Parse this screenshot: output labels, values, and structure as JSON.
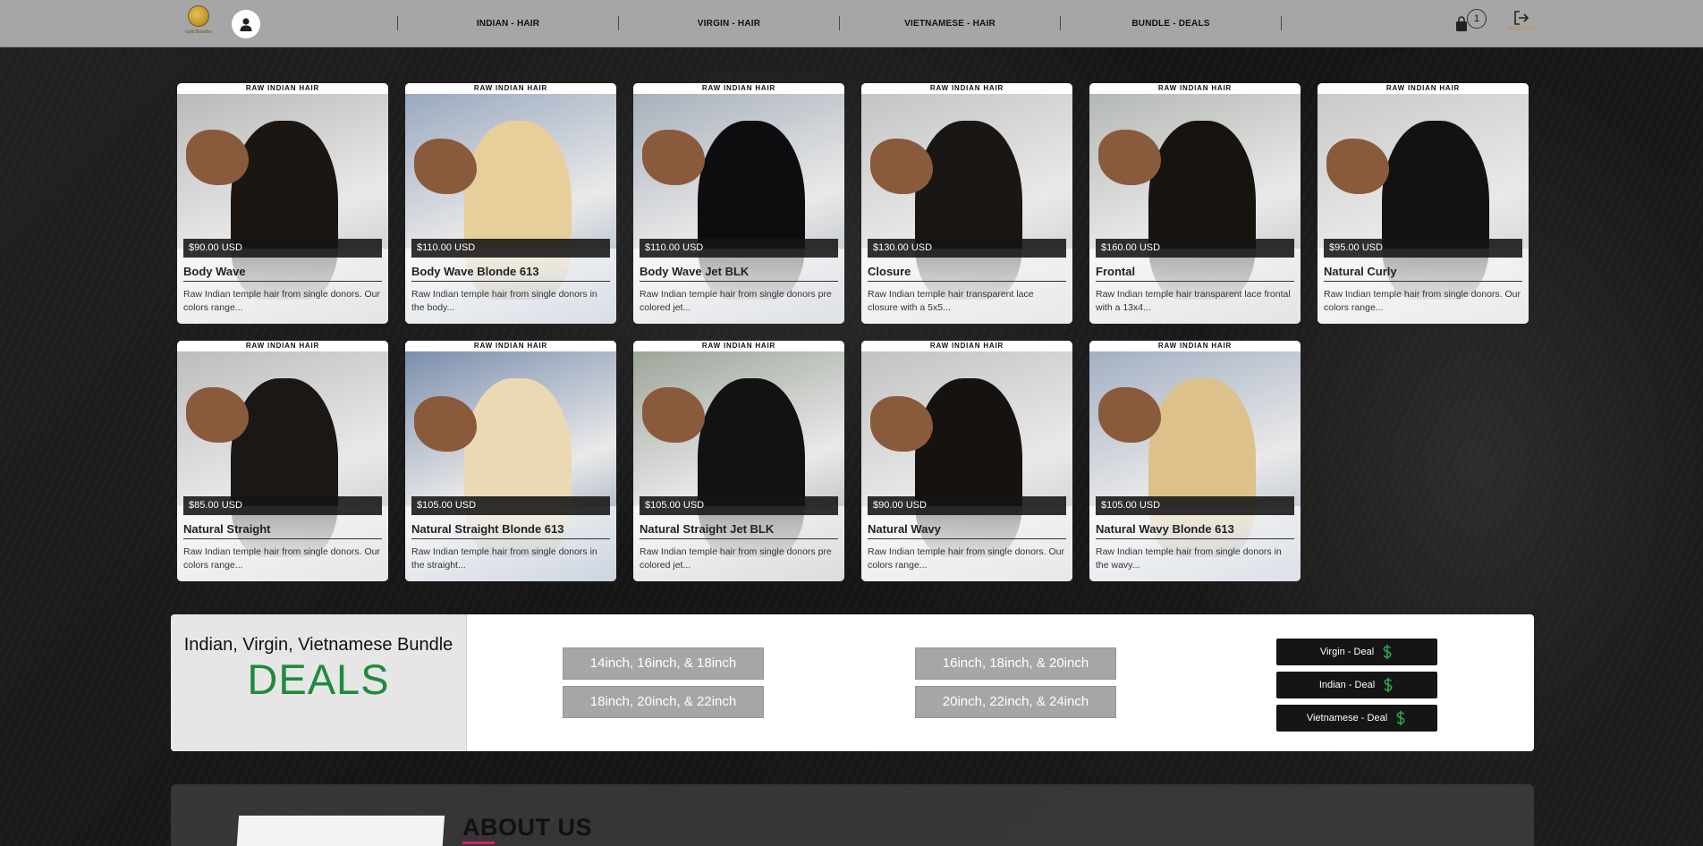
{
  "header": {
    "logo_text": "Gold Bundles",
    "nav": [
      "INDIAN - HAIR",
      "VIRGIN - HAIR",
      "VIETNAMESE - HAIR",
      "BUNDLE - DEALS"
    ],
    "cart_count": "1",
    "signout_label": "SIGN OUT"
  },
  "products": [
    {
      "category": "RAW INDIAN HAIR",
      "price": "$90.00 USD",
      "name": "Body Wave",
      "desc": "Raw Indian temple hair from single donors. Our colors range...",
      "hair_color": "#1c1613",
      "bg_color": "#b9b9b9"
    },
    {
      "category": "RAW INDIAN HAIR",
      "price": "$110.00 USD",
      "name": "Body Wave Blonde 613",
      "desc": "Raw Indian temple hair from single donors in the body...",
      "hair_color": "#e6cf9a",
      "bg_color": "#9aa9bf"
    },
    {
      "category": "RAW INDIAN HAIR",
      "price": "$110.00 USD",
      "name": "Body Wave Jet BLK",
      "desc": "Raw Indian temple hair from single donors pre colored jet...",
      "hair_color": "#0d0d10",
      "bg_color": "#a8b0bb"
    },
    {
      "category": "RAW INDIAN HAIR",
      "price": "$130.00 USD",
      "name": "Closure",
      "desc": "Raw Indian temple hair transparent lace closure with a 5x5...",
      "hair_color": "#1a1614",
      "bg_color": "#c4c4c4"
    },
    {
      "category": "RAW INDIAN HAIR",
      "price": "$160.00 USD",
      "name": "Frontal",
      "desc": "Raw Indian temple hair transparent lace frontal with a 13x4...",
      "hair_color": "#17130f",
      "bg_color": "#b4b8b4"
    },
    {
      "category": "RAW INDIAN HAIR",
      "price": "$95.00 USD",
      "name": "Natural Curly",
      "desc": "Raw Indian temple hair from single donors. Our colors range...",
      "hair_color": "#141111",
      "bg_color": "#c9c9c9"
    },
    {
      "category": "RAW INDIAN HAIR",
      "price": "$85.00 USD",
      "name": "Natural Straight",
      "desc": "Raw Indian temple hair from single donors. Our colors range...",
      "hair_color": "#1b1715",
      "bg_color": "#bdbdbd"
    },
    {
      "category": "RAW INDIAN HAIR",
      "price": "$105.00 USD",
      "name": "Natural Straight Blonde 613",
      "desc": "Raw Indian temple hair from single donors in the straight...",
      "hair_color": "#ead9b3",
      "bg_color": "#7c8fae"
    },
    {
      "category": "RAW INDIAN HAIR",
      "price": "$105.00 USD",
      "name": "Natural Straight Jet BLK",
      "desc": "Raw Indian temple hair from single donors pre colored jet...",
      "hair_color": "#131212",
      "bg_color": "#9da59a"
    },
    {
      "category": "RAW INDIAN HAIR",
      "price": "$90.00 USD",
      "name": "Natural Wavy",
      "desc": "Raw Indian temple hair from single donors. Our colors range...",
      "hair_color": "#15120f",
      "bg_color": "#c2c2c2"
    },
    {
      "category": "RAW INDIAN HAIR",
      "price": "$105.00 USD",
      "name": "Natural Wavy Blonde 613",
      "desc": "Raw Indian temple hair from single donors in the wavy...",
      "hair_color": "#dcc18a",
      "bg_color": "#a3afc2"
    }
  ],
  "deals": {
    "title": "Indian, Virgin, Vietnamese Bundle",
    "big": "DEALS",
    "sizes": [
      "14inch, 16inch, & 18inch",
      "16inch, 18inch, & 20inch",
      "18inch, 20inch, & 22inch",
      "20inch, 22inch, & 24inch"
    ],
    "deal_buttons": [
      "Virgin - Deal",
      "Indian - Deal",
      "Vietnamese - Deal"
    ],
    "accent_color": "#1f8a3e"
  },
  "about": {
    "title": "ABOUT US"
  }
}
